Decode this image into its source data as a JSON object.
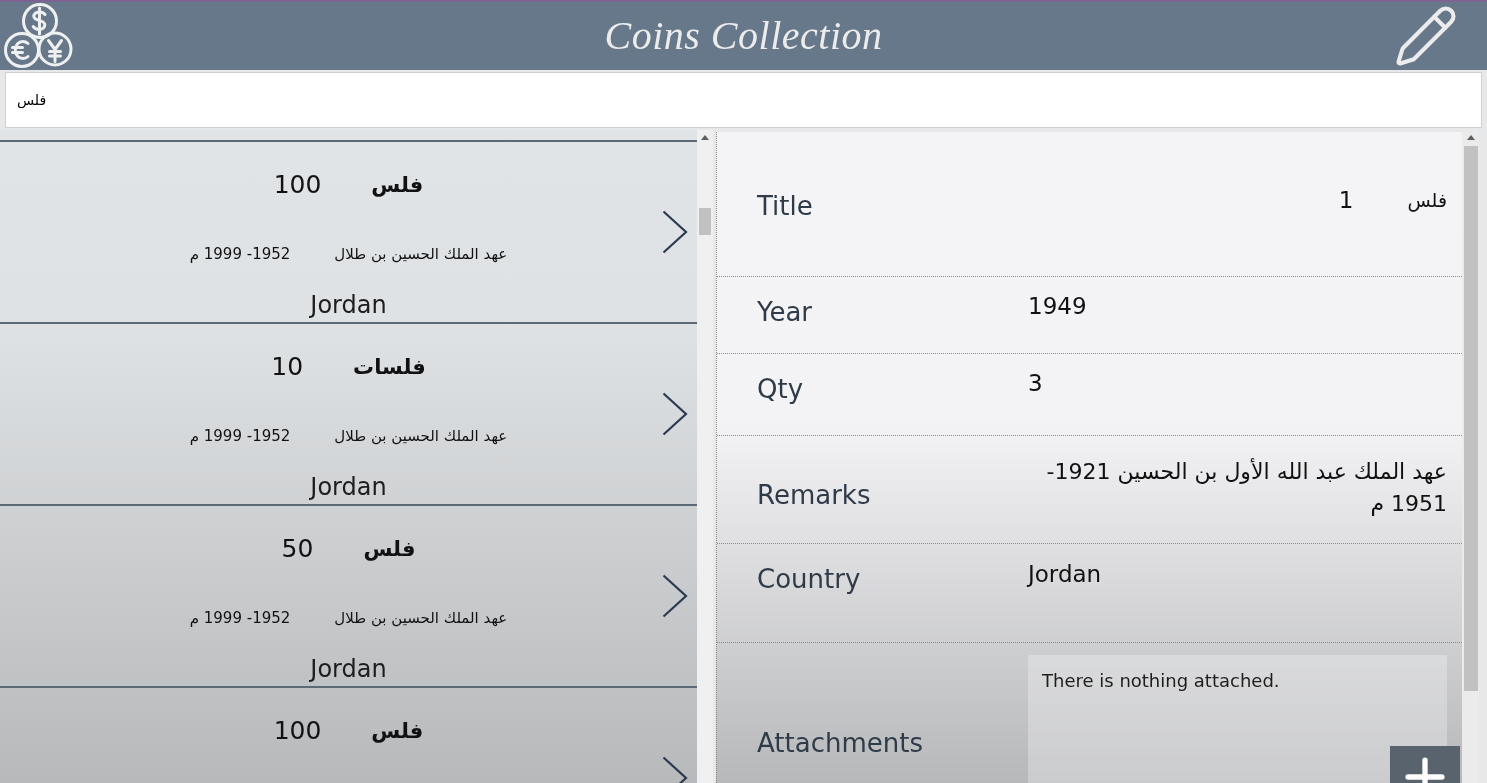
{
  "header": {
    "title": "Coins Collection"
  },
  "search": {
    "value": "فلس"
  },
  "coin_list": {
    "items": [
      {
        "denomination": "فلس",
        "amount": "100",
        "era": "عهد الملك الحسين بن طلال",
        "years": "1952- 1999 م",
        "country": "Jordan"
      },
      {
        "denomination": "فلسات",
        "amount": "10",
        "era": "عهد الملك الحسين بن طلال",
        "years": "1952- 1999 م",
        "country": "Jordan"
      },
      {
        "denomination": "فلس",
        "amount": "50",
        "era": "عهد الملك الحسين بن طلال",
        "years": "1952- 1999 م",
        "country": "Jordan"
      },
      {
        "denomination": "فلس",
        "amount": "100"
      }
    ]
  },
  "details": {
    "fields": [
      {
        "kind": "split",
        "label": "Title",
        "unit": "فلس",
        "number": "1"
      },
      {
        "kind": "plain",
        "label": "Year",
        "value": "1949"
      },
      {
        "kind": "plain",
        "label": "Qty",
        "value": "3"
      },
      {
        "kind": "rtl",
        "label": "Remarks",
        "value": "عهد الملك عبد الله الأول بن الحسين 1921- 1951 م"
      },
      {
        "kind": "plain",
        "label": "Country",
        "value": "Jordan"
      }
    ],
    "attachments": {
      "label": "Attachments",
      "message": "There is nothing attached."
    }
  }
}
